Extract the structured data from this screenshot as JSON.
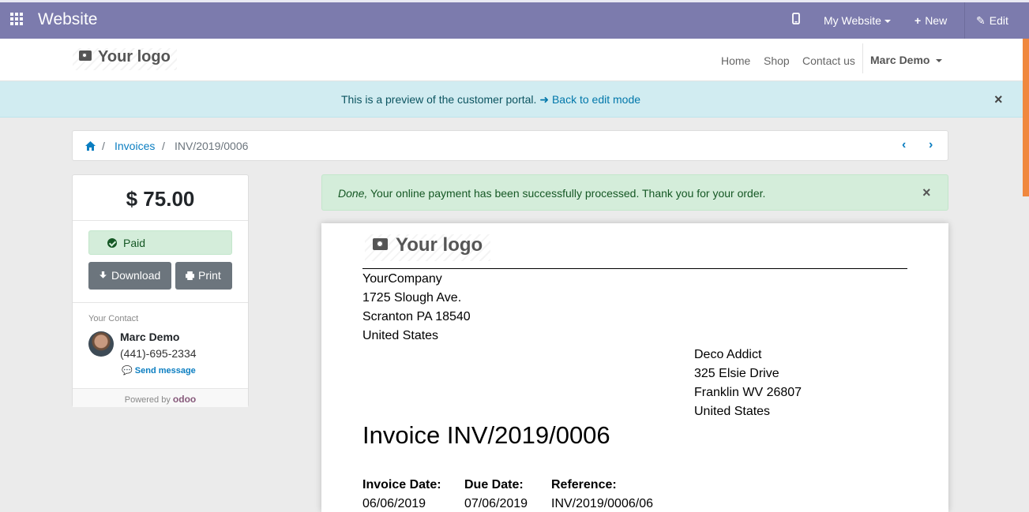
{
  "topbar": {
    "title": "Website",
    "my_website": "My Website",
    "new": "New",
    "edit": "Edit"
  },
  "header": {
    "logo": "Your logo",
    "nav": [
      "Home",
      "Shop",
      "Contact us"
    ],
    "user": "Marc Demo"
  },
  "preview_alert": {
    "message": "This is a preview of the customer portal.",
    "link": "Back to edit mode",
    "close": "×"
  },
  "breadcrumb": {
    "items": [
      "Invoices",
      "INV/2019/0006"
    ],
    "separator": "/"
  },
  "sidebar": {
    "amount": "$ 75.00",
    "status": "Paid",
    "download": "Download",
    "print": "Print",
    "contact_heading": "Your Contact",
    "contact_name": "Marc Demo",
    "contact_phone": "(441)-695-2334",
    "send_message": "Send message",
    "powered_by": "Powered by",
    "powered_brand": "odoo"
  },
  "success_alert": {
    "emphasis": "Done,",
    "message": "Your online payment has been successfully processed. Thank you for your order.",
    "close": "×"
  },
  "invoice": {
    "logo": "Your logo",
    "company_lines": [
      "YourCompany",
      "1725 Slough Ave.",
      "Scranton PA 18540",
      "United States"
    ],
    "customer_lines": [
      "Deco Addict",
      "325 Elsie Drive",
      "Franklin WV 26807",
      "United States"
    ],
    "title": "Invoice INV/2019/0006",
    "fields": [
      {
        "label": "Invoice Date:",
        "value": "06/06/2019"
      },
      {
        "label": "Due Date:",
        "value": "07/06/2019"
      },
      {
        "label": "Reference:",
        "value": "INV/2019/0006/06"
      }
    ]
  },
  "colors": {
    "topbar": "#7c7bad",
    "link": "#0b7ec1",
    "success_bg": "#d4edda",
    "info_bg": "#d1ecf1",
    "button": "#6c757d"
  }
}
